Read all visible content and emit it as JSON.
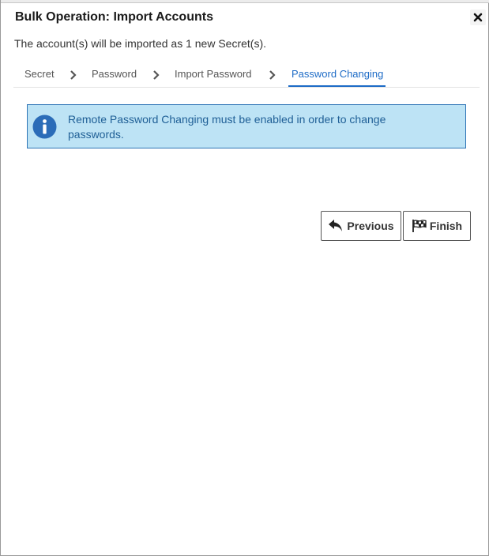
{
  "dialog": {
    "title": "Bulk Operation: Import Accounts",
    "subtitle": "The account(s) will be imported as 1 new Secret(s)."
  },
  "steps": {
    "items": [
      {
        "label": "Secret",
        "active": false
      },
      {
        "label": "Password",
        "active": false
      },
      {
        "label": "Import Password",
        "active": false
      },
      {
        "label": "Password Changing",
        "active": true
      }
    ]
  },
  "alert": {
    "icon": "info-icon",
    "message": "Remote Password Changing must be enabled in order to change passwords.",
    "colors": {
      "background": "#bde3f5",
      "border": "#2e74b5",
      "icon": "#2b6cb8"
    }
  },
  "buttons": {
    "previous_label": "Previous",
    "previous_icon": "reply-arrow-icon",
    "finish_label": "Finish",
    "finish_icon": "checkered-flag-icon"
  },
  "colors": {
    "accent": "#1d6bc6"
  }
}
